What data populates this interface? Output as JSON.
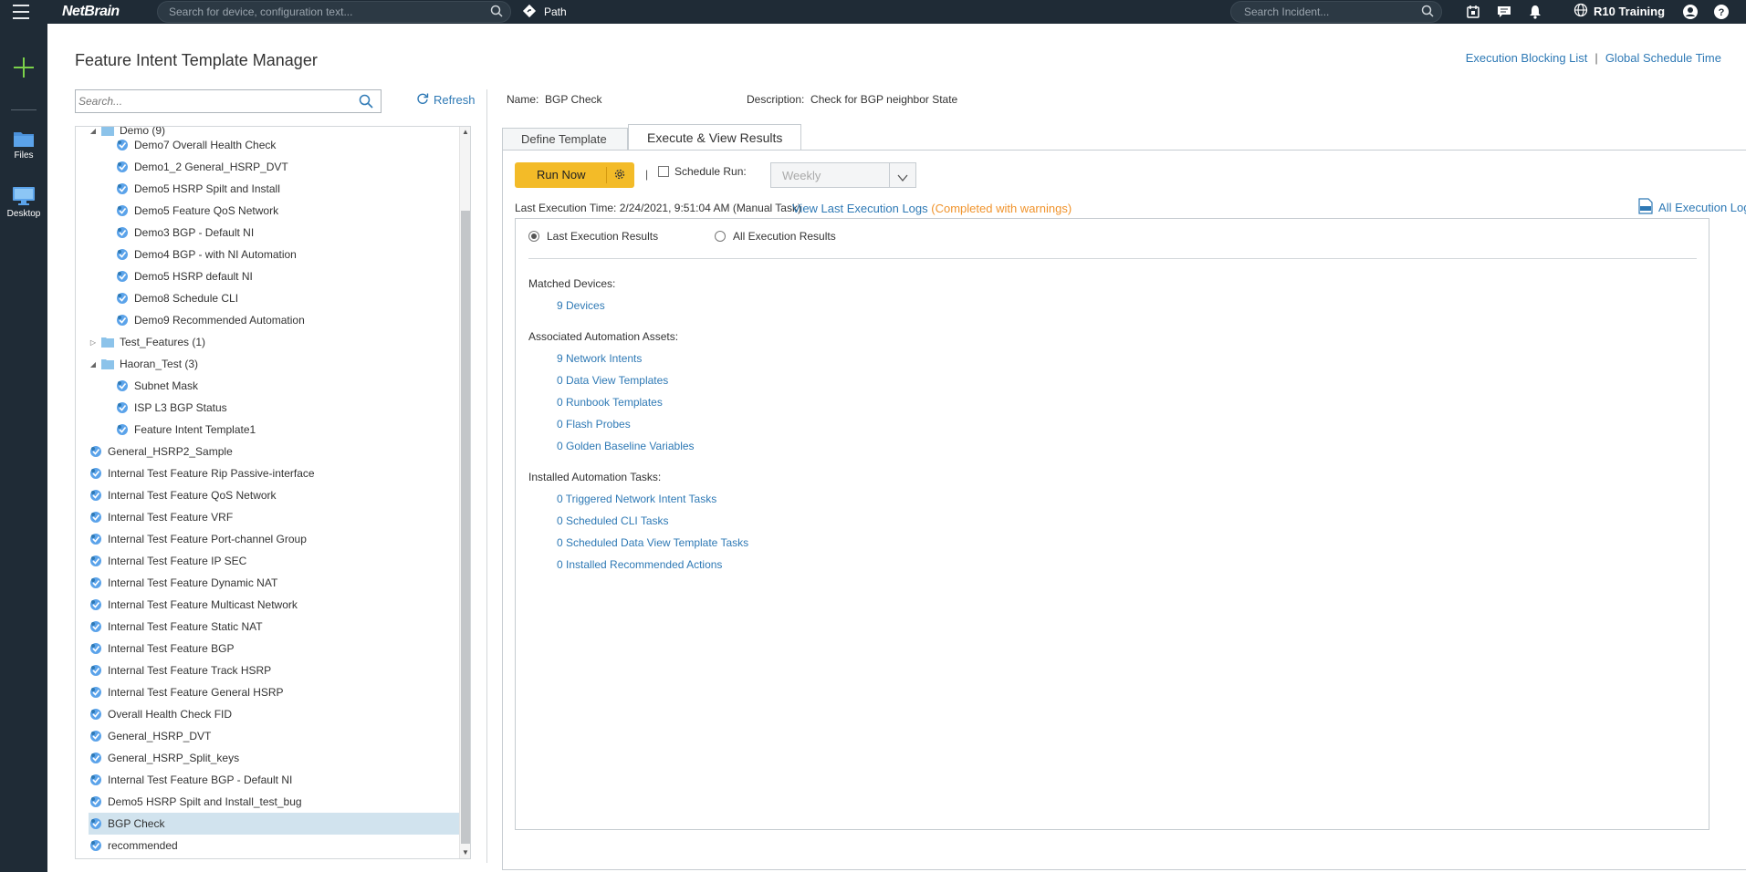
{
  "topbar": {
    "logo": "NetBrain",
    "search_placeholder": "Search for device, configuration text...",
    "path_label": "Path",
    "incident_placeholder": "Search Incident...",
    "user_label": "R10 Training",
    "icons": [
      "hamburger-icon",
      "search-icon",
      "path-icon",
      "calendar-icon",
      "chat-icon",
      "bell-icon",
      "globe-icon",
      "user-icon",
      "help-icon"
    ]
  },
  "rail": {
    "files_label": "Files",
    "desktop_label": "Desktop"
  },
  "page": {
    "title": "Feature Intent Template Manager",
    "link_blocking": "Execution Blocking List",
    "link_separator": "|",
    "link_schedule": "Global Schedule Time"
  },
  "tree": {
    "search_placeholder": "Search...",
    "refresh_label": "Refresh",
    "partial_top": "Demo (9)",
    "rows": [
      {
        "label": "Demo7 Overall Health Check",
        "level": 2
      },
      {
        "label": "Demo1_2 General_HSRP_DVT",
        "level": 2
      },
      {
        "label": "Demo5 HSRP Spilt and Install",
        "level": 2
      },
      {
        "label": "Demo5 Feature QoS Network",
        "level": 2
      },
      {
        "label": "Demo3 BGP - Default NI",
        "level": 2
      },
      {
        "label": "Demo4 BGP - with NI Automation",
        "level": 2
      },
      {
        "label": "Demo5 HSRP default NI",
        "level": 2
      },
      {
        "label": "Demo8 Schedule CLI",
        "level": 2
      },
      {
        "label": "Demo9 Recommended Automation",
        "level": 2
      },
      {
        "label": "Test_Features (1)",
        "level": 1,
        "folder": true,
        "toggle": "▷"
      },
      {
        "label": "Haoran_Test (3)",
        "level": 1,
        "folder": true,
        "toggle": "◢"
      },
      {
        "label": "Subnet Mask",
        "level": 2
      },
      {
        "label": "ISP L3 BGP Status",
        "level": 2
      },
      {
        "label": "Feature Intent Template1",
        "level": 2
      },
      {
        "label": "General_HSRP2_Sample",
        "level": 1
      },
      {
        "label": "Internal Test Feature Rip Passive-interface",
        "level": 1
      },
      {
        "label": "Internal Test Feature QoS Network",
        "level": 1
      },
      {
        "label": "Internal Test Feature VRF",
        "level": 1
      },
      {
        "label": "Internal Test Feature Port-channel Group",
        "level": 1
      },
      {
        "label": "Internal Test Feature IP SEC",
        "level": 1
      },
      {
        "label": "Internal Test Feature Dynamic NAT",
        "level": 1
      },
      {
        "label": "Internal Test Feature Multicast Network",
        "level": 1
      },
      {
        "label": "Internal Test Feature Static NAT",
        "level": 1
      },
      {
        "label": "Internal Test Feature BGP",
        "level": 1
      },
      {
        "label": "Internal Test Feature Track HSRP",
        "level": 1
      },
      {
        "label": "Internal Test Feature General HSRP",
        "level": 1
      },
      {
        "label": "Overall Health Check FID",
        "level": 1
      },
      {
        "label": "General_HSRP_DVT",
        "level": 1
      },
      {
        "label": "General_HSRP_Split_keys",
        "level": 1
      },
      {
        "label": "Internal Test Feature BGP - Default NI",
        "level": 1
      },
      {
        "label": "Demo5 HSRP Spilt and Install_test_bug",
        "level": 1
      },
      {
        "label": "BGP Check",
        "level": 1,
        "selected": true
      },
      {
        "label": "recommended",
        "level": 1
      }
    ]
  },
  "detail": {
    "name_label": "Name:",
    "name_value": "BGP Check",
    "desc_label": "Description:",
    "desc_value": "Check for BGP neighbor State",
    "tabs": [
      "Define Template",
      "Execute & View Results"
    ],
    "run_now": "Run Now",
    "pipe": "|",
    "schedule_run": "Schedule Run:",
    "schedule_value": "Weekly",
    "last_exec": "Last Execution Time: 2/24/2021, 9:51:04 AM (Manual Task)",
    "view_logs": "View Last Execution Logs",
    "view_logs_status": "(Completed with warnings)",
    "all_logs": "All Execution Logs",
    "radio_last": "Last Execution Results",
    "radio_all": "All Execution Results",
    "matched_label": "Matched Devices:",
    "matched_links": [
      "9 Devices"
    ],
    "assets_label": "Associated Automation Assets:",
    "assets_links": [
      "9 Network Intents",
      "0 Data View Templates",
      "0 Runbook Templates",
      "0 Flash Probes",
      "0 Golden Baseline Variables"
    ],
    "tasks_label": "Installed Automation Tasks:",
    "tasks_links": [
      "0 Triggered Network Intent Tasks",
      "0 Scheduled CLI Tasks",
      "0 Scheduled Data View Template Tasks",
      "0 Installed Recommended Actions"
    ]
  },
  "colors": {
    "topbar": "#1f2b36",
    "link": "#2e79b5",
    "run_button": "#f3bb28",
    "warning": "#f0932b",
    "selected_row": "#d1e3ee"
  }
}
